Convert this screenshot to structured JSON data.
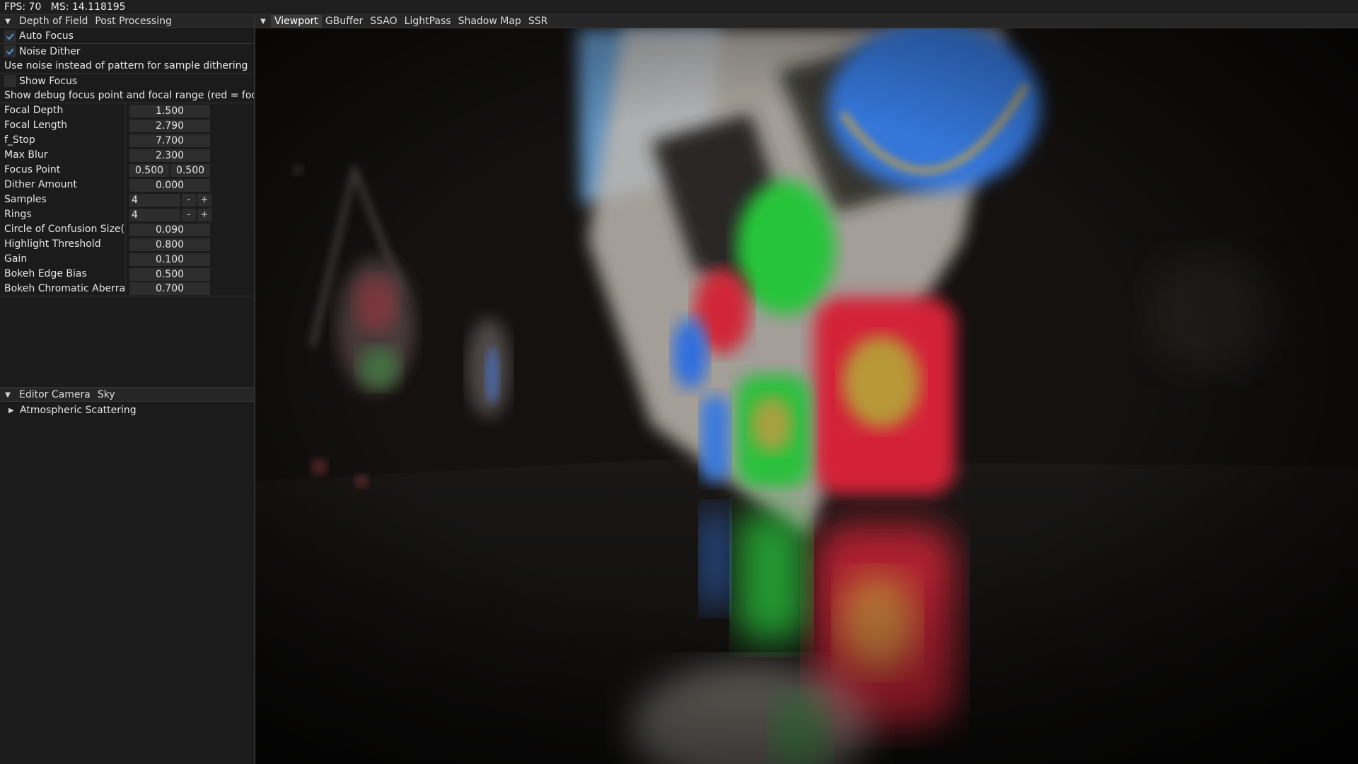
{
  "stats": {
    "fps_label": "FPS: 70",
    "ms_label": "MS: 14.118195"
  },
  "left_panel_tabs": [
    "Depth of Field",
    "Post Processing"
  ],
  "depth_of_field": {
    "auto_focus": {
      "label": "Auto Focus",
      "checked": true
    },
    "noise_dither": {
      "label": "Noise Dither",
      "checked": true
    },
    "noise_dither_hint": "Use noise instead of pattern for sample dithering",
    "show_focus": {
      "label": "Show Focus",
      "checked": false
    },
    "show_focus_hint": "Show debug focus point and focal range (red = focal p",
    "properties": [
      {
        "name": "Focal Depth",
        "value": "1.500"
      },
      {
        "name": "Focal Length",
        "value": "2.790"
      },
      {
        "name": "f_Stop",
        "value": "7.700"
      },
      {
        "name": "Max Blur",
        "value": "2.300"
      },
      {
        "name": "Focus Point",
        "values": [
          "0.500",
          "0.500"
        ]
      },
      {
        "name": "Dither Amount",
        "value": "0.000"
      },
      {
        "name": "Samples",
        "value": "4",
        "stepper": true
      },
      {
        "name": "Rings",
        "value": "4",
        "stepper": true
      },
      {
        "name": "Circle of Confusion Size(mm)",
        "value": "0.090"
      },
      {
        "name": "Highlight Threshold",
        "value": "0.800"
      },
      {
        "name": "Gain",
        "value": "0.100"
      },
      {
        "name": "Bokeh Edge Bias",
        "value": "0.500"
      },
      {
        "name": "Bokeh Chromatic Aberration",
        "value": "0.700"
      }
    ],
    "stepper_minus": "-",
    "stepper_plus": "+"
  },
  "lower_panel_tabs": [
    "Editor Camera",
    "Sky"
  ],
  "sky": {
    "tree_item": "Atmospheric Scattering"
  },
  "viewport_tabs": [
    "Viewport",
    "GBuffer",
    "SSAO",
    "LightPass",
    "Shadow Map",
    "SSR"
  ],
  "viewport_active_tab": "Viewport",
  "colors": {
    "panel_bg": "#1b1b1b",
    "field_bg": "#2d2d2d",
    "check_blue": "#4a9ae8",
    "banner_red": "#d8283c",
    "banner_green": "#2cc83c",
    "banner_blue": "#3478e0"
  }
}
